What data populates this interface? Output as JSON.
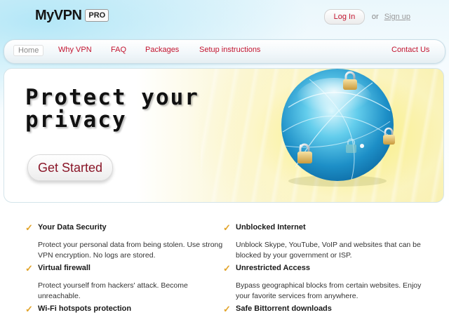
{
  "header": {
    "logo_text": "MyVPN",
    "logo_badge": "PRO",
    "login_label": "Log In",
    "or_text": "or",
    "signup_label": "Sign up"
  },
  "nav": {
    "items": [
      {
        "label": "Home"
      },
      {
        "label": "Why VPN"
      },
      {
        "label": "FAQ"
      },
      {
        "label": "Packages"
      },
      {
        "label": "Setup instructions"
      },
      {
        "label": "Contact Us"
      }
    ]
  },
  "hero": {
    "title_line1": "Protect your",
    "title_line2": "privacy",
    "cta_label": "Get Started",
    "image": "globe-with-padlocks-illustration"
  },
  "features": [
    {
      "title": "Your Data Security",
      "description": "Protect your personal data from being stolen. Use strong VPN encryption. No logs are stored."
    },
    {
      "title": "Unblocked Internet",
      "description": "Unblock Skype, YouTube, VoIP and websites that can be blocked by your government or ISP."
    },
    {
      "title": "Virtual firewall",
      "description": "Protect yourself from hackers' attack. Become unreachable."
    },
    {
      "title": "Unrestricted Access",
      "description": "Bypass geographical blocks from certain websites. Enjoy your favorite services from anywhere."
    },
    {
      "title": "Wi-Fi hotspots protection",
      "description": ""
    },
    {
      "title": "Safe Bittorrent downloads",
      "description": ""
    }
  ],
  "colors": {
    "accent": "#c3142f",
    "check": "#e2a42a",
    "cta_text": "#8a1628"
  },
  "icons": {
    "check": "check-icon",
    "padlock": "padlock-icon"
  }
}
